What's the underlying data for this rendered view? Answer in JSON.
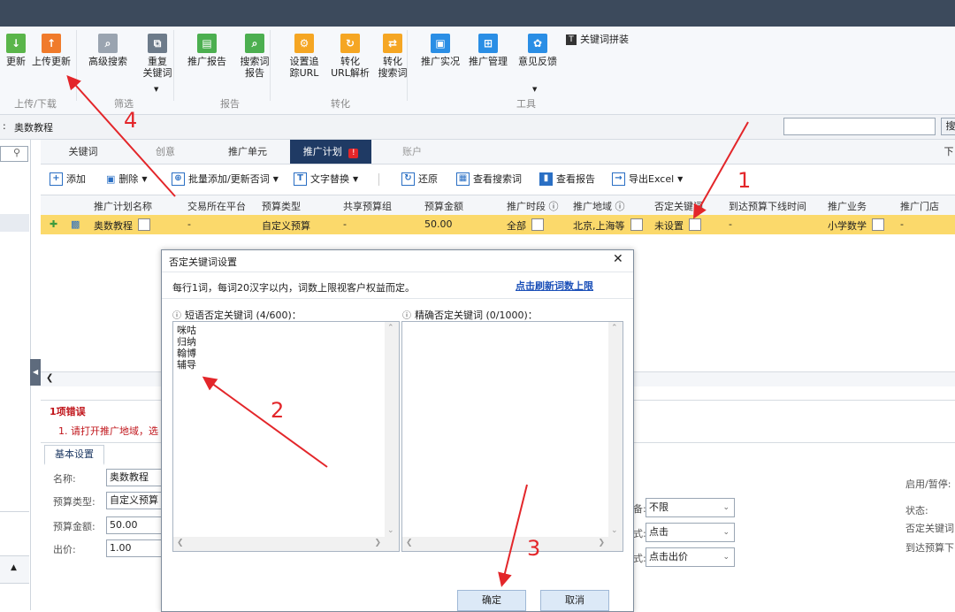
{
  "ribbon": {
    "buttons": [
      {
        "label": "更新",
        "icon": "download-icon",
        "color": "#5ab54a"
      },
      {
        "label": "上传更新",
        "icon": "upload-icon",
        "color": "#f07b2b"
      },
      {
        "label": "高级搜索",
        "icon": "search-icon",
        "color": "#9aa4b0"
      },
      {
        "label": "重复\n关键词",
        "icon": "duplicate-icon",
        "color": "#6d7b8a"
      },
      {
        "label": "推广报告",
        "icon": "report-chart-icon",
        "color": "#4caf50"
      },
      {
        "label": "搜索词\n报告",
        "icon": "search-report-icon",
        "color": "#4caf50"
      },
      {
        "label": "设置追\n踪URL",
        "icon": "tracking-gear-icon",
        "color": "#f5a623"
      },
      {
        "label": "转化\nURL解析",
        "icon": "refresh-icon",
        "color": "#f5a623"
      },
      {
        "label": "转化\n搜索词",
        "icon": "convert-search-icon",
        "color": "#f5a623"
      },
      {
        "label": "推广实况",
        "icon": "live-preview-icon",
        "color": "#2a8ee5"
      },
      {
        "label": "推广管理",
        "icon": "manage-icon",
        "color": "#2a8ee5"
      },
      {
        "label": "意见反馈",
        "icon": "paw-feedback-icon",
        "color": "#2a8ee5"
      },
      {
        "label": "关键词拼装",
        "icon": "keyword-assemble-icon",
        "color": "#333333"
      }
    ],
    "groups": [
      "上传/下载",
      "筛选",
      "报告",
      "转化",
      "工具"
    ]
  },
  "breadcrumb": {
    "prefix": ":",
    "label": "奥数教程"
  },
  "search_button": "搜",
  "tabs": [
    "关键词",
    "创意",
    "推广单元",
    "推广计划",
    "账户"
  ],
  "tab_badge": "!",
  "right_edge_label": "下",
  "toolbar": {
    "add": "添加",
    "delete": "删除",
    "batch": "批量添加/更新否词",
    "replace": "文字替换",
    "restore": "还原",
    "view_search_terms": "查看搜索词",
    "view_report": "查看报告",
    "export": "导出Excel"
  },
  "grid": {
    "headers": [
      "推广计划名称",
      "交易所在平台",
      "预算类型",
      "共享预算组",
      "预算金额",
      "推广时段",
      "推广地域",
      "否定关键词",
      "到达预算下线时间",
      "推广业务",
      "推广门店"
    ],
    "row": {
      "name": "奥数教程",
      "platform": "-",
      "budget_type": "自定义预算",
      "shared_group": "-",
      "budget": "50.00",
      "schedule": "全部",
      "region": "北京,上海等",
      "negative_kw": "未设置",
      "offline_time": "-",
      "business": "小学数学",
      "store": "-"
    }
  },
  "errors": {
    "title": "1项错误",
    "message": "1. 请打开推广地域，选"
  },
  "basic": {
    "tab": "基本设置",
    "name_label": "名称:",
    "name_value": "奥数教程",
    "budget_type_label": "预算类型:",
    "budget_type_value": "自定义预算",
    "budget_label": "预算金额:",
    "budget_value": "50.00",
    "bid_label": "出价:",
    "bid_value": "1.00",
    "sel1_suffix": "备:",
    "sel1_value": "不限",
    "sel2_suffix": "式:",
    "sel2_value": "点击",
    "sel3_suffix": "式:",
    "sel3_value": "点击出价",
    "right_labels": [
      "启用/暂停:",
      "状态:",
      "否定关键词",
      "到达预算下"
    ]
  },
  "dialog": {
    "title": "否定关键词设置",
    "desc": "每行1词，每词20汉字以内，词数上限视客户权益而定。",
    "refresh_link": "点击刷新词数上限",
    "phrase_label": "短语否定关键词 (4/600)：",
    "exact_label": "精确否定关键词 (0/1000)：",
    "phrase_words": [
      "咪咕",
      "归纳",
      "翰博",
      "辅导"
    ],
    "ok": "确定",
    "cancel": "取消"
  },
  "annotations": [
    "1",
    "2",
    "3",
    "4"
  ],
  "colors": {
    "annotation": "#e3262a",
    "selected_row": "#fbd96b",
    "active_tab": "#1f3a64",
    "link": "#1a4fb8",
    "error": "#c0141a"
  }
}
